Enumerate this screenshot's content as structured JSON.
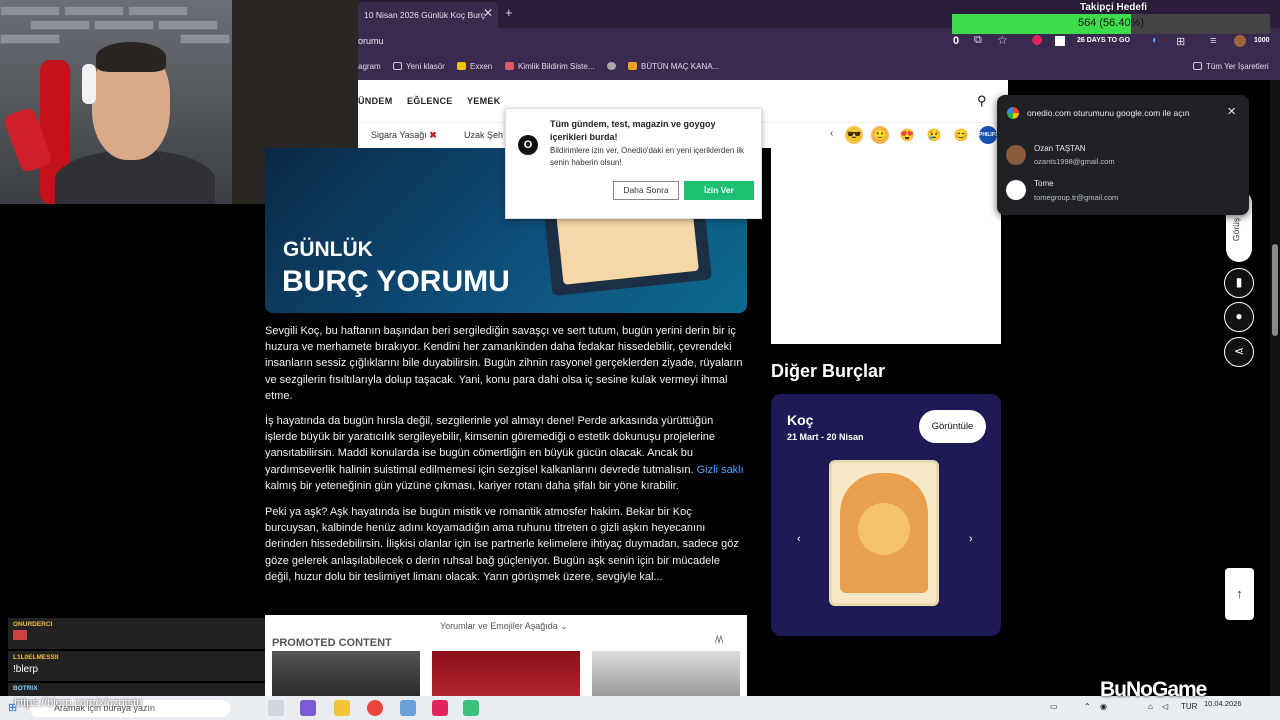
{
  "browser": {
    "tab_title": "10 Nisan 2026 Günlük Koç Burç",
    "tab_close": "✕",
    "new_tab": "+",
    "url_fragment": "orumu",
    "bookmarks": [
      "agram",
      "Yeni klasör",
      "Exxen",
      "Kimlik Bildirim Siste...",
      "",
      "BÜTÜN MAÇ KANA..."
    ],
    "all_bookmarks": "Tüm Yer İşaretleri",
    "ext_counter": "0",
    "ext_badge": "26 DAYS TO GO",
    "ext_count2": "1000"
  },
  "goal": {
    "title": "Takipçi Hedefi",
    "text": "564 (56.40%)",
    "progress": 0.564,
    "color": "#3ddc4a"
  },
  "nav": {
    "items": [
      "ÜNDEM",
      "EĞLENCE",
      "YEMEK"
    ],
    "subnav": [
      "Sigara Yasağı",
      "Uzak Şeh"
    ]
  },
  "notification": {
    "title": "Tüm gündem, test, magazin ve goygoy içerikleri burda!",
    "body": "Bildirimlere izin ver, Onedio'daki en yeni içeriklerden ilk senin haberin olsun!",
    "later": "Daha Sonra",
    "allow": "İzin Ver"
  },
  "google_popup": {
    "title": "onedio.com oturumunu google.com ile açın",
    "accounts": [
      {
        "name": "Ozan TAŞTAN",
        "email": "ozants1998@gmail.com"
      },
      {
        "name": "Tome",
        "email": "tomegroup.tr@gmail.com"
      }
    ]
  },
  "hero": {
    "small": "GÜNLÜK",
    "big": "BURÇ YORUMU"
  },
  "article": {
    "p1": "Sevgili Koç, bu haftanın başından beri sergilediğin savaşçı ve sert tutum, bugün yerini derin bir iç huzura ve merhamete bırakıyor. Kendini her zamankinden daha fedakar hissedebilir, çevrendeki insanların sessiz çığlıklarını bile duyabilirsin. Bugün zihnin rasyonel gerçeklerden ziyade, rüyaların ve sezgilerin fısıltılarıyla dolup taşacak. Yani, konu para dahi olsa iç sesine kulak vermeyi ihmal etme.",
    "p2_a": "İş hayatında da bugün hırsla değil, sezgilerinle yol almayı dene! Perde arkasında yürüttüğün işlerde büyük bir yaratıcılık sergileyebilir, kimsenin göremediği o estetik dokunuşu projelerine yansıtabilirsin. Maddi konularda ise bugün cömertliğin en büyük gücün olacak. Ancak bu yardımseverlik halinin suistimal edilmemesi için sezgisel kalkanlarını devrede tutmalısın.",
    "p2_link": "Gizli saklı",
    "p2_b": "kalmış bir yeteneğinin gün yüzüne çıkması, kariyer rotanı daha şifalı bir yöne kırabilir.",
    "p3": "Peki ya aşk? Aşk hayatında ise bugün mistik ve romantik atmosfer hakim. Bekar bir Koç burcuysan, kalbinde henüz adını koyamadığın ama ruhunu titreten o gizli aşkın heyecanını derinden hissedebilirsin. İlişkisi olanlar için ise partnerle kelimelere ihtiyaç duymadan, sadece göz göze gelerek anlaşılabilecek o derin ruhsal bağ güçleniyor. Bugün aşk senin için bir mücadele değil, huzur dolu bir teslimiyet limanı olacak. Yarın görüşmek üzere, sevgiyle kal..."
  },
  "comments": {
    "label": "Yorumlar ve Emojiler Aşağıda ⌄",
    "promoted": "PROMOTED CONTENT",
    "promo_logo": "/\\/\\"
  },
  "sidebar": {
    "other_title": "Diğer Burçlar",
    "sign_name": "Koç",
    "sign_dates": "21 Mart - 20 Nisan",
    "view_button": "Görüntüle",
    "side_tab": "Görüş Bi"
  },
  "chat": {
    "messages": [
      {
        "user": "ONURDERCI",
        "msg": ""
      },
      {
        "user": "L1L0ELMESSII",
        "msg": "!blerp"
      },
      {
        "user": "BOTRIX",
        "msg": ""
      }
    ],
    "blerp_url": "https://blerp.com/x/ozntstn"
  },
  "taskbar": {
    "search": "Aramak için buraya yazın",
    "lang": "TUR",
    "date": "10.04.2026"
  },
  "brand": "BuNoGame"
}
